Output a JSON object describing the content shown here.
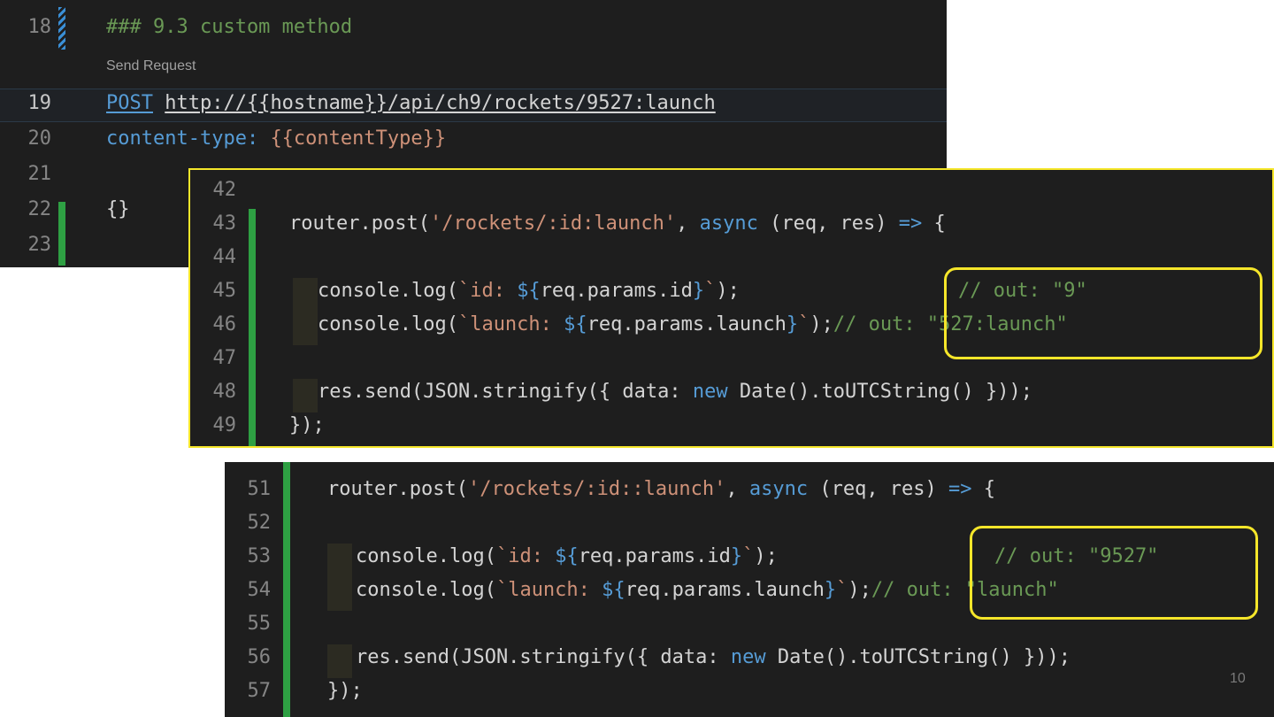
{
  "http_panel": {
    "lines": [
      {
        "num": "18",
        "header": "### 9.3 custom method"
      },
      {
        "codelens": "Send Request"
      },
      {
        "num": "19",
        "method": "POST",
        "url": "http://{{hostname}}/api/ch9/rockets/9527:launch"
      },
      {
        "num": "20",
        "key": "content-type:",
        "value": "{{contentType}}"
      },
      {
        "num": "21"
      },
      {
        "num": "22",
        "body": "{}"
      },
      {
        "num": "23"
      }
    ]
  },
  "panel_a": {
    "lines": [
      {
        "num": "42"
      },
      {
        "num": "43",
        "p1": "router.post(",
        "str": "'/rockets/:id:launch'",
        "p2": ", ",
        "kw": "async",
        "p3": " (req, res) ",
        "arrow": "=>",
        "p4": " {"
      },
      {
        "num": "44"
      },
      {
        "num": "45",
        "p1": "console.log(",
        "t1": "`id: ",
        "i1": "${",
        "p2": "req.params.id",
        "i2": "}",
        "t2": "`",
        "p3": ");",
        "comment": "// out: \"9\""
      },
      {
        "num": "46",
        "p1": "console.log(",
        "t1": "`launch: ",
        "i1": "${",
        "p2": "req.params.launch",
        "i2": "}",
        "t2": "`",
        "p3": ");",
        "comment": "// out: \"527:launch\""
      },
      {
        "num": "47"
      },
      {
        "num": "48",
        "p1": "res.send(JSON.stringify({ data: ",
        "kw": "new",
        "p2": " Date().toUTCString() }));"
      },
      {
        "num": "49",
        "p1": "});"
      }
    ]
  },
  "panel_b": {
    "lines": [
      {
        "num": "51",
        "p1": "router.post(",
        "str": "'/rockets/:id::launch'",
        "p2": ", ",
        "kw": "async",
        "p3": " (req, res) ",
        "arrow": "=>",
        "p4": " {"
      },
      {
        "num": "52"
      },
      {
        "num": "53",
        "p1": "console.log(",
        "t1": "`id: ",
        "i1": "${",
        "p2": "req.params.id",
        "i2": "}",
        "t2": "`",
        "p3": ");",
        "comment": "// out: \"9527\""
      },
      {
        "num": "54",
        "p1": "console.log(",
        "t1": "`launch: ",
        "i1": "${",
        "p2": "req.params.launch",
        "i2": "}",
        "t2": "`",
        "p3": ");",
        "comment": "// out: \"launch\""
      },
      {
        "num": "55"
      },
      {
        "num": "56",
        "p1": "res.send(JSON.stringify({ data: ",
        "kw": "new",
        "p2": " Date().toUTCString() }));"
      },
      {
        "num": "57",
        "p1": "});"
      }
    ]
  },
  "slide_number": "10",
  "colors": {
    "editor_bg": "#1e1e1e",
    "highlight_border": "#f5e62a",
    "modified_bar": "#2ea043",
    "keyword": "#569cd6",
    "string": "#ce9178",
    "comment": "#6a9955"
  }
}
